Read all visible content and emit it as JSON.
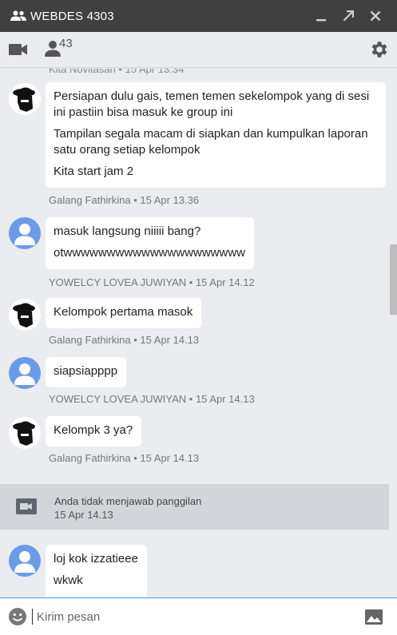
{
  "window": {
    "title": "WEBDES 4303"
  },
  "toolbar": {
    "member_count": "43"
  },
  "chat": {
    "cutoff_meta": "Kita Novitasari • 15 Apr 13.34",
    "messages": [
      {
        "sender": "Galang Fathirkina",
        "meta": "Galang Fathirkina • 15 Apr 13.36",
        "lines": [
          "Persiapan dulu gais, temen temen sekelompok yang di sesi ini pastiin bisa masuk ke group ini",
          "Tampilan segala macam di siapkan dan kumpulkan laporan satu orang setiap kelompok",
          "Kita start jam 2"
        ]
      },
      {
        "sender": "YOWELCY LOVEA JUWIYAN",
        "meta": "YOWELCY LOVEA JUWIYAN • 15 Apr 14.12",
        "lines": [
          "masuk langsung niiiii bang?",
          "otwwwwwwwwwwwwwwwwwwwww"
        ]
      },
      {
        "sender": "Galang Fathirkina",
        "meta": "Galang Fathirkina • 15 Apr 14.13",
        "lines": [
          "Kelompok pertama masok"
        ]
      },
      {
        "sender": "YOWELCY LOVEA JUWIYAN",
        "meta": "YOWELCY LOVEA JUWIYAN • 15 Apr 14.13",
        "lines": [
          "siapsiapppp"
        ]
      },
      {
        "sender": "Galang Fathirkina",
        "meta": "Galang Fathirkina • 15 Apr 14.13",
        "lines": [
          "Kelompk 3 ya?"
        ]
      },
      {
        "sender": "YOWELCY LOVEA JUWIYAN",
        "meta": "",
        "lines": [
          "loj kok izzatieee",
          "wkwk"
        ]
      }
    ],
    "missed_call": {
      "text": "Anda tidak menjawab panggilan",
      "time": "15 Apr 14.13"
    }
  },
  "composer": {
    "placeholder": "Kirim pesan"
  },
  "colors": {
    "titlebar": "#404040",
    "accent": "#4b9be0",
    "avatar_blue": "#6a9be8"
  }
}
